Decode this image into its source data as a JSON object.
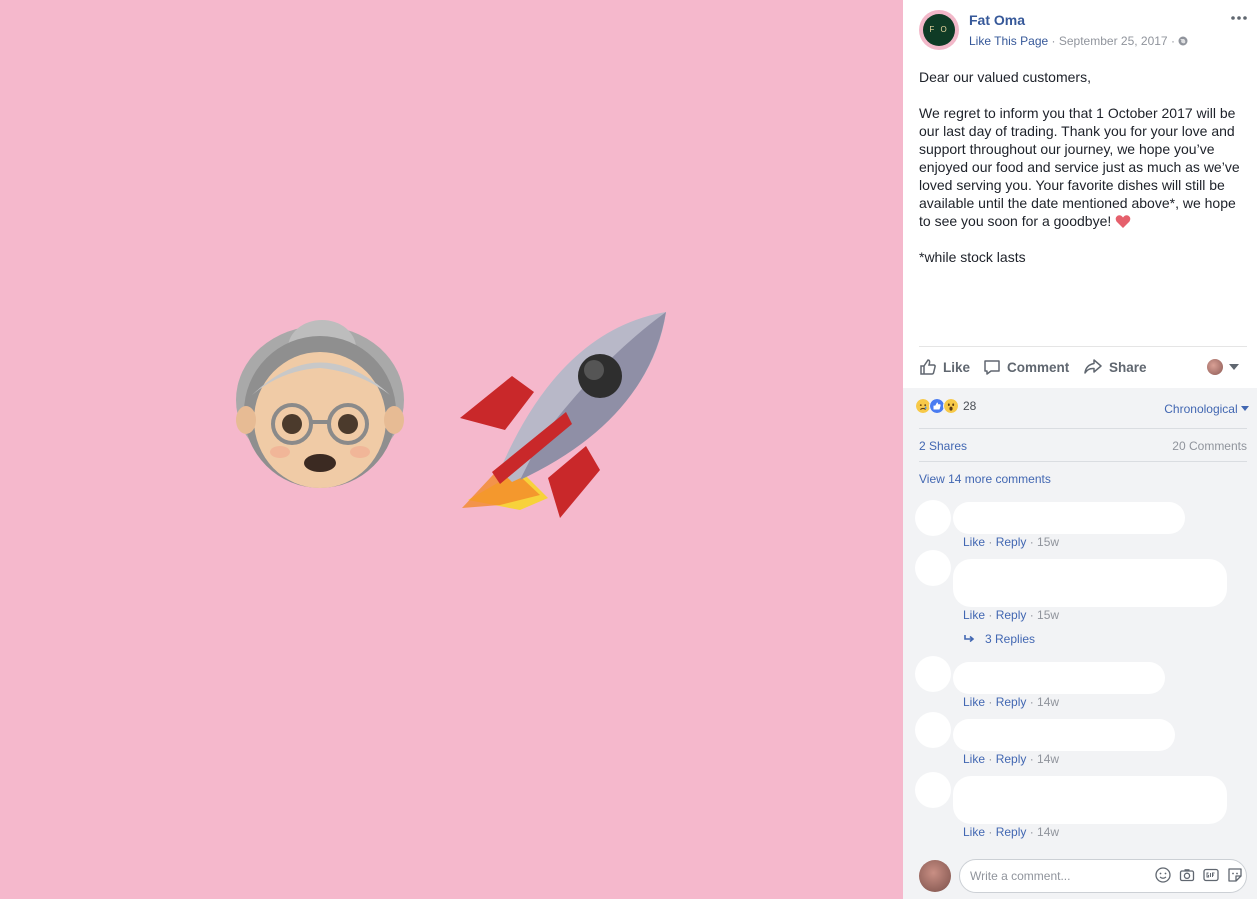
{
  "post": {
    "page_name": "Fat Oma",
    "avatar_initials": "F O",
    "like_page": "Like This Page",
    "date": "September 25, 2017",
    "separator": "·",
    "paragraphs": [
      "Dear our valued customers,",
      "We regret to inform you that 1 October 2017 will be our last day of trading. Thank you for your love and support throughout our journey, we hope you’ve enjoyed our food and service just as much as we’ve loved serving you. Your favorite dishes will still be available until the date mentioned above*, we hope to see you soon for a goodbye!",
      "*while stock lasts"
    ],
    "photo_background": "#f5b8cc"
  },
  "actions": {
    "like": "Like",
    "comment": "Comment",
    "share": "Share"
  },
  "reactions": {
    "count": "28",
    "icons": [
      "sad-reaction-icon",
      "like-reaction-icon",
      "wow-reaction-icon"
    ],
    "sort": "Chronological"
  },
  "stats": {
    "shares": "2 Shares",
    "comments": "20 Comments"
  },
  "view_more": "View 14 more comments",
  "comments": [
    {
      "like": "Like",
      "reply": "Reply",
      "time": "15w"
    },
    {
      "like": "Like",
      "reply": "Reply",
      "time": "15w"
    },
    {
      "like": "Like",
      "reply": "Reply",
      "time": "14w"
    },
    {
      "like": "Like",
      "reply": "Reply",
      "time": "14w"
    },
    {
      "like": "Like",
      "reply": "Reply",
      "time": "14w"
    }
  ],
  "replies_link": "3 Replies",
  "composer": {
    "placeholder": "Write a comment..."
  },
  "colors": {
    "brand_link": "#365899",
    "action_blue": "#4267b2",
    "muted": "#90949c"
  }
}
